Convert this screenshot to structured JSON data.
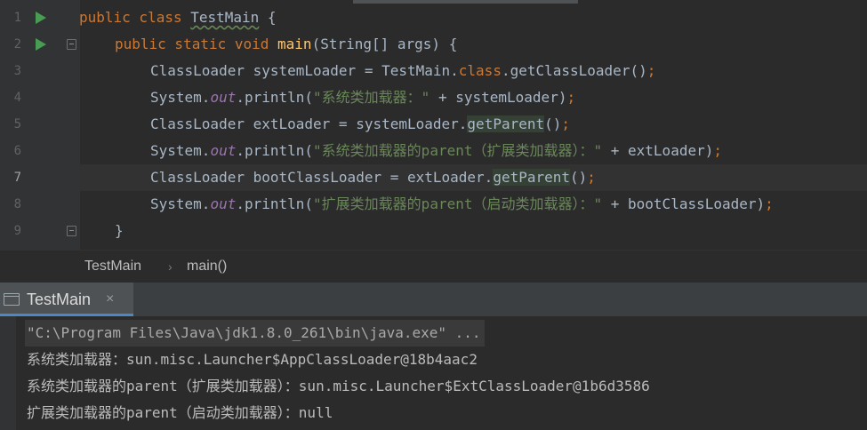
{
  "editor": {
    "lines": [
      {
        "num": "1",
        "tokens": {
          "kw": "public class ",
          "name": "TestMain",
          "rest": " {"
        }
      },
      {
        "num": "2",
        "tokens": {
          "kw": "public static void ",
          "fn": "main",
          "rest": "(String[] args) {"
        }
      },
      {
        "num": "3",
        "tokens": {
          "a": "ClassLoader systemLoader = TestMain.",
          "kw": "class",
          "b": ".getClassLoader()",
          "semi": ";"
        }
      },
      {
        "num": "4",
        "tokens": {
          "a": "System.",
          "field": "out",
          "b": ".println(",
          "str": "\"系统类加载器：\"",
          "c": " + systemLoader)",
          "semi": ";"
        }
      },
      {
        "num": "5",
        "tokens": {
          "a": "ClassLoader extLoader = systemLoader.",
          "hl": "getParent",
          "b": "()",
          "semi": ";"
        }
      },
      {
        "num": "6",
        "tokens": {
          "a": "System.",
          "field": "out",
          "b": ".println(",
          "str": "\"系统类加载器的parent（扩展类加载器）：\"",
          "c": " + extLoader)",
          "semi": ";"
        }
      },
      {
        "num": "7",
        "tokens": {
          "a": "ClassLoader bootClassLoader = extLoader.",
          "hl": "getParent",
          "b": "()",
          "semi": ";"
        }
      },
      {
        "num": "8",
        "tokens": {
          "a": "System.",
          "field": "out",
          "b": ".println(",
          "str": "\"扩展类加载器的parent（启动类加载器）：\"",
          "c": " + bootClassLoader)",
          "semi": ";"
        }
      },
      {
        "num": "9",
        "tokens": {
          "a": "}"
        }
      }
    ]
  },
  "breadcrumb": {
    "items": [
      "TestMain",
      "main()"
    ],
    "separator": "›"
  },
  "run_window": {
    "tab_label": "TestMain",
    "close_glyph": "×",
    "console_lines": [
      "\"C:\\Program Files\\Java\\jdk1.8.0_261\\bin\\java.exe\" ...",
      "系统类加载器：sun.misc.Launcher$AppClassLoader@18b4aac2",
      "系统类加载器的parent（扩展类加载器）：sun.misc.Launcher$ExtClassLoader@1b6d3586",
      "扩展类加载器的parent（启动类加载器）：null"
    ]
  },
  "icons": [
    "run-gutter-icon",
    "fold-icon",
    "console-tab-icon",
    "close-icon"
  ],
  "colors": {
    "background": "#2b2b2b",
    "gutter": "#313335",
    "keyword": "#cc7832",
    "method": "#ffc66d",
    "string": "#6a8759",
    "static_field": "#9876aa",
    "run_icon": "#499c54",
    "tab_underline": "#4a88c7"
  }
}
